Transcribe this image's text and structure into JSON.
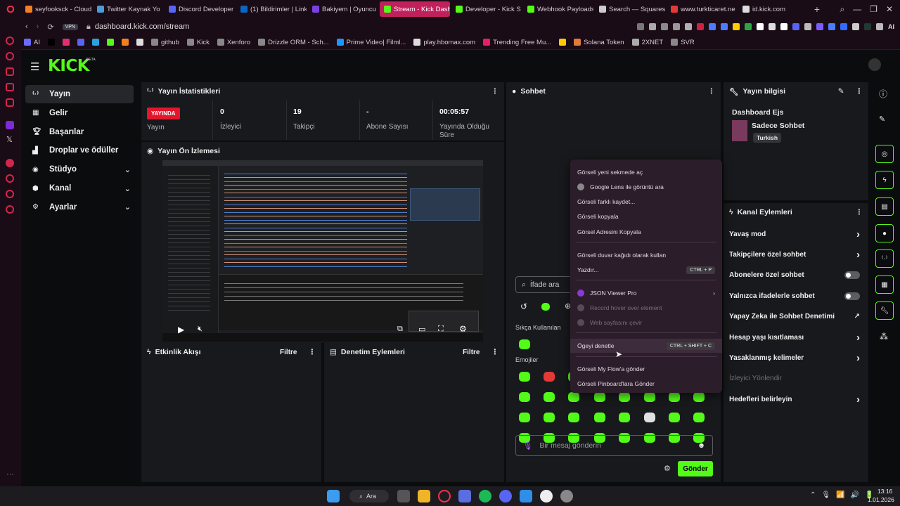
{
  "browser": {
    "tabs": [
      {
        "title": "seyfooksck - Cloud",
        "color": "#f38020"
      },
      {
        "title": "Twitter Kaynak Yo",
        "color": "#4a9bd8"
      },
      {
        "title": "Discord Developer",
        "color": "#5865f2"
      },
      {
        "title": "(1) Bildirimler | Link",
        "color": "#0a66c2"
      },
      {
        "title": "Bakiyem | Oyuncu",
        "color": "#7b3fe4"
      },
      {
        "title": "Stream - Kick Dashboard",
        "color": "#53fc18",
        "active": true
      },
      {
        "title": "Developer - Kick S",
        "color": "#53fc18"
      },
      {
        "title": "Webhook Payloads",
        "color": "#53fc18"
      },
      {
        "title": "Search — Squares",
        "color": "#cccccc"
      },
      {
        "title": "www.turkticaret.ne",
        "color": "#e53935"
      },
      {
        "title": "id.kick.com",
        "color": "#dddddd"
      }
    ],
    "vpn_label": "VPN",
    "url": "dashboard.kick.com/stream",
    "ai_label": "AI",
    "bookmarks": [
      {
        "label": "AI",
        "color": "#6b6bff"
      },
      {
        "label": "",
        "color": "#000000"
      },
      {
        "label": "",
        "color": "#e1306c"
      },
      {
        "label": "",
        "color": "#5865f2"
      },
      {
        "label": "",
        "color": "#2aa1da"
      },
      {
        "label": "",
        "color": "#53fc18"
      },
      {
        "label": "",
        "color": "#f38020"
      },
      {
        "label": "",
        "color": "#dddddd"
      },
      {
        "label": "github",
        "color": "#888888"
      },
      {
        "label": "Kick",
        "color": "#888888"
      },
      {
        "label": "Xenforo",
        "color": "#888888"
      },
      {
        "label": "Drizzle ORM - Sch...",
        "color": "#888888"
      },
      {
        "label": "Prime Video| Filml...",
        "color": "#1a98ff"
      },
      {
        "label": "play.hbomax.com",
        "color": "#dddddd"
      },
      {
        "label": "Trending Free Mu...",
        "color": "#e91e63"
      },
      {
        "label": "",
        "color": "#ffcc00"
      },
      {
        "label": "Solana Token",
        "color": "#e07b39"
      },
      {
        "label": "2XNET",
        "color": "#aaaaaa"
      },
      {
        "label": "SVR",
        "color": "#888888"
      }
    ]
  },
  "kick": {
    "logo": "KICK",
    "beta": "BETA",
    "nav": [
      {
        "label": "Yayın",
        "icon": "broadcast-icon",
        "active": true
      },
      {
        "label": "Gelir",
        "icon": "revenue-icon"
      },
      {
        "label": "Başarılar",
        "icon": "trophy-icon"
      },
      {
        "label": "Droplar ve ödüller",
        "icon": "gift-icon"
      },
      {
        "label": "Stüdyo",
        "icon": "studio-icon",
        "expandable": true
      },
      {
        "label": "Kanal",
        "icon": "channel-icon",
        "expandable": true
      },
      {
        "label": "Ayarlar",
        "icon": "settings-icon",
        "expandable": true
      }
    ],
    "stats": {
      "title": "Yayın İstatistikleri",
      "live_badge": "YAYINDA",
      "live_label": "Yayın",
      "items": [
        {
          "value": "0",
          "label": "İzleyici"
        },
        {
          "value": "19",
          "label": "Takipçi"
        },
        {
          "value": "-",
          "label": "Abone Sayısı"
        },
        {
          "value": "00:05:57",
          "label": "Yayında Olduğu Süre"
        }
      ]
    },
    "preview": {
      "title": "Yayın Ön İzlemesi"
    },
    "activity": {
      "title": "Etkinlik Akışı",
      "filter": "Filtre"
    },
    "moderation": {
      "title": "Denetim Eylemleri",
      "filter": "Filtre"
    },
    "chat": {
      "title": "Sohbet",
      "emote_search_placeholder": "İfade ara",
      "frequently_used": "Sıkça Kullanılan",
      "emojis": "Emojiler",
      "message_placeholder": "Bir mesaj gönderin",
      "send": "Gönder"
    },
    "stream_info": {
      "title": "Yayın bilgisi",
      "stream_title": "Dashboard Ejs",
      "category": "Sadece Sohbet",
      "language": "Turkish"
    },
    "channel_actions": {
      "title": "Kanal Eylemleri",
      "items": [
        {
          "label": "Yavaş mod",
          "type": "chevron"
        },
        {
          "label": "Takipçilere özel sohbet",
          "type": "chevron"
        },
        {
          "label": "Abonelere özel sohbet",
          "type": "toggle"
        },
        {
          "label": "Yalnızca ifadelerle sohbet",
          "type": "toggle"
        },
        {
          "label": "Yapay Zeka ile Sohbet Denetimi",
          "type": "external"
        },
        {
          "label": "Hesap yaşı kısıtlaması",
          "type": "chevron"
        },
        {
          "label": "Yasaklanmış kelimeler",
          "type": "chevron"
        },
        {
          "label": "İzleyici Yönlendir",
          "type": "disabled"
        },
        {
          "label": "Hedefleri belirleyin",
          "type": "chevron"
        }
      ]
    }
  },
  "context_menu": {
    "items": [
      {
        "label": "Görseli yeni sekmede aç"
      },
      {
        "label": "Google Lens ile görüntü ara",
        "icon": true
      },
      {
        "label": "Görseli farklı kaydet..."
      },
      {
        "label": "Görseli kopyala"
      },
      {
        "label": "Görsel Adresini Kopyala"
      },
      {
        "label": "Görseli duvar kağıdı olarak kullan"
      },
      {
        "label": "Yazdır...",
        "shortcut": "CTRL + P"
      },
      {
        "label": "JSON Viewer Pro",
        "icon": true,
        "submenu": true
      },
      {
        "label": "Record hover over element",
        "icon": true,
        "disabled": true
      },
      {
        "label": "Web sayfasını çevir",
        "icon": true,
        "disabled": true
      },
      {
        "label": "Ögeyi denetle",
        "shortcut": "CTRL + SHIFT + C",
        "hover": true
      },
      {
        "label": "Görseli My Flow'a gönder"
      },
      {
        "label": "Görseli Pinboard'lara Gönder"
      }
    ]
  },
  "taskbar": {
    "search": "Ara",
    "time": "13:16",
    "date": "1.01.2026"
  },
  "colors": {
    "kick_green": "#53fc18",
    "live_red": "#e3162c",
    "opera_red": "#ff2e4d"
  }
}
